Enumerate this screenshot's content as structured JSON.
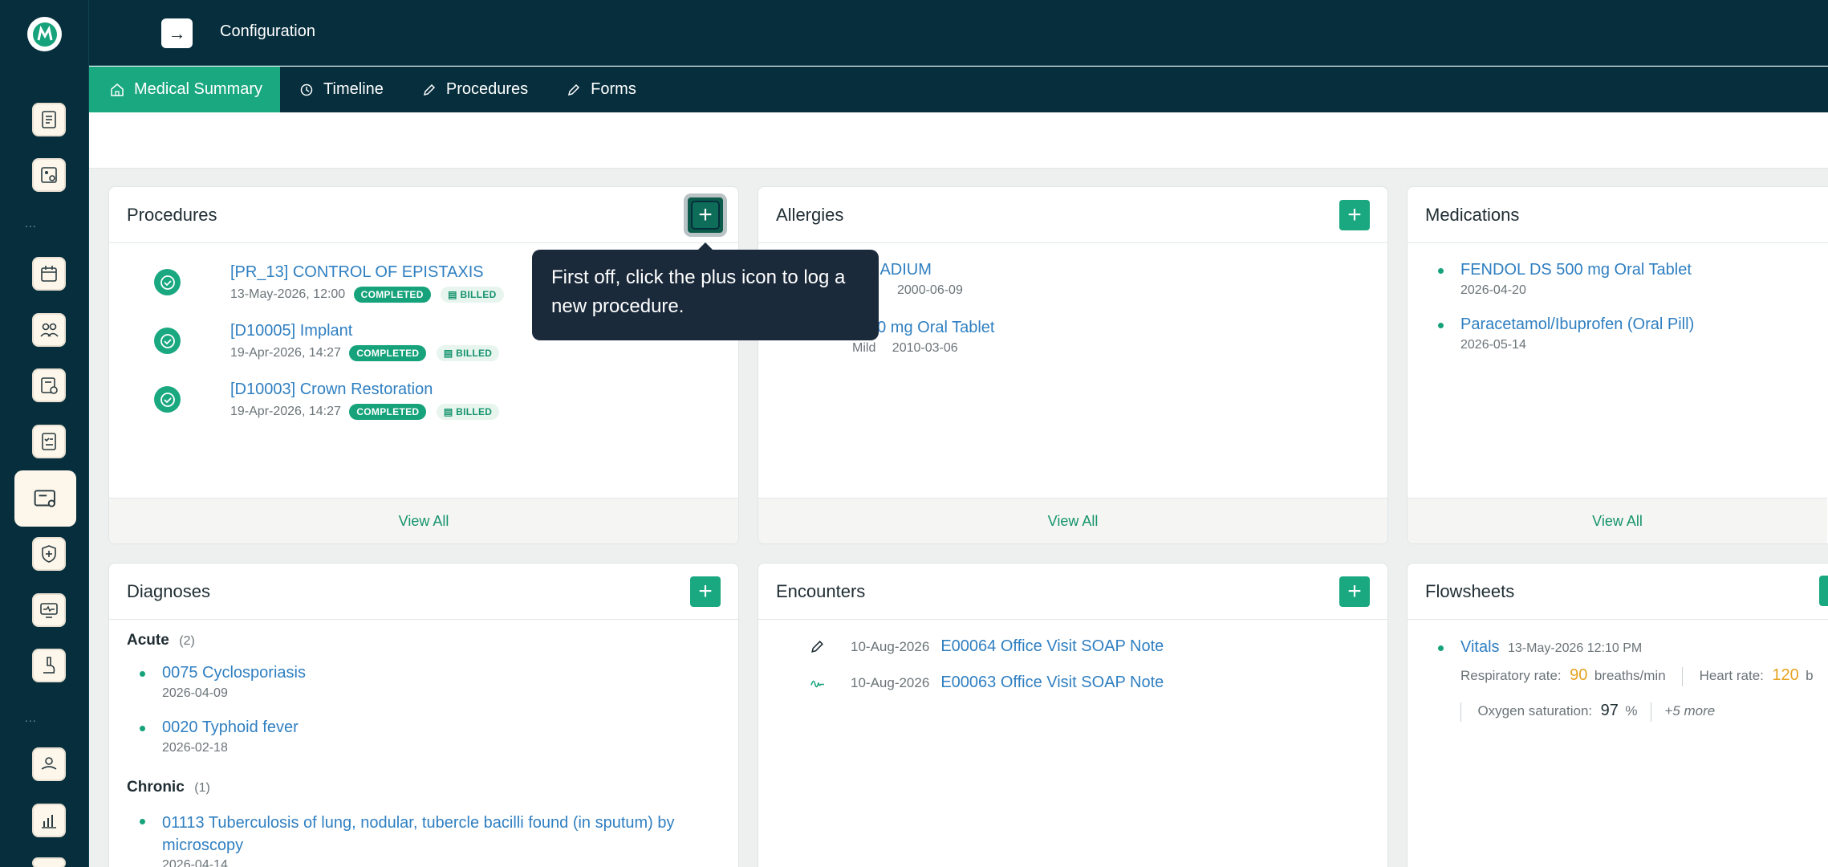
{
  "header": {
    "title": "Configuration",
    "expand_icon": "arrow-right-icon",
    "colors": {
      "bg": "#062e3c",
      "accent": "#1aa880"
    }
  },
  "tabs": [
    {
      "label": "Medical Summary",
      "icon": "home-icon",
      "active": true
    },
    {
      "label": "Timeline",
      "icon": "history-icon",
      "active": false
    },
    {
      "label": "Procedures",
      "icon": "pencil-icon",
      "active": false
    },
    {
      "label": "Forms",
      "icon": "pencil-icon",
      "active": false
    }
  ],
  "rail": {
    "dots": "...",
    "items": [
      "clipboard-icon",
      "calculator-icon",
      "calendar-icon",
      "users-icon",
      "billing-icon",
      "checklist-icon",
      "patient-card-icon",
      "insurance-icon",
      "monitor-health-icon",
      "microscope-icon",
      "care-icon",
      "analytics-icon"
    ]
  },
  "procedures": {
    "title": "Procedures",
    "items": [
      {
        "name": "[PR_13] CONTROL OF EPISTAXIS",
        "date": "13-May-2026, 12:00",
        "status": "COMPLETED",
        "billing": "BILLED"
      },
      {
        "name": "[D10005] Implant",
        "date": "19-Apr-2026, 14:27",
        "status": "COMPLETED",
        "billing": "BILLED"
      },
      {
        "name": "[D10003] Crown Restoration",
        "date": "19-Apr-2026, 14:27",
        "status": "COMPLETED",
        "billing": "BILLED"
      }
    ],
    "view_all": "View All"
  },
  "allergies": {
    "title": "Allergies",
    "items": [
      {
        "name": "NADIUM",
        "severity": "",
        "date": "2000-06-09"
      },
      {
        "name": "00 mg Oral Tablet",
        "severity": "Mild",
        "date": "2010-03-06"
      }
    ],
    "view_all": "View All"
  },
  "medications": {
    "title": "Medications",
    "items": [
      {
        "name": "FENDOL DS 500 mg Oral Tablet",
        "date": "2026-04-20"
      },
      {
        "name": "Paracetamol/Ibuprofen (Oral Pill)",
        "date": "2026-05-14"
      }
    ],
    "view_all": "View All"
  },
  "diagnoses": {
    "title": "Diagnoses",
    "groups": [
      {
        "label": "Acute",
        "count": "(2)",
        "items": [
          {
            "name": "0075 Cyclosporiasis",
            "date": "2026-04-09"
          },
          {
            "name": "0020 Typhoid fever",
            "date": "2026-02-18"
          }
        ]
      },
      {
        "label": "Chronic",
        "count": "(1)",
        "items": [
          {
            "name": "01113 Tuberculosis of lung, nodular, tubercle bacilli found (in sputum) by microscopy",
            "date": "2026-04-14"
          }
        ]
      }
    ]
  },
  "encounters": {
    "title": "Encounters",
    "items": [
      {
        "date": "10-Aug-2026",
        "name": "E00064 Office Visit SOAP Note",
        "icon": "pencil-icon"
      },
      {
        "date": "10-Aug-2026",
        "name": "E00063 Office Visit SOAP Note",
        "icon": "signature-icon"
      }
    ]
  },
  "flowsheets": {
    "title": "Flowsheets",
    "vitals_label": "Vitals",
    "vitals_time": "13-May-2026 12:10 PM",
    "respiratory_label": "Respiratory rate:",
    "respiratory_value": "90",
    "respiratory_unit": "breaths/min",
    "heart_label": "Heart rate:",
    "heart_value": "120",
    "heart_unit": "b",
    "oxygen_label": "Oxygen saturation:",
    "oxygen_value": "97",
    "oxygen_unit": "%",
    "more": "+5 more"
  },
  "tooltip": {
    "text": "First off, click the plus icon to log a new procedure."
  }
}
